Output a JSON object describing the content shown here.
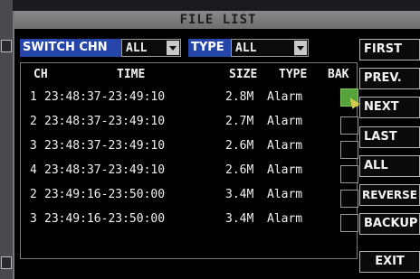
{
  "window": {
    "title": "FILE LIST"
  },
  "filters": {
    "switch_chn_label": "SWITCH CHN",
    "switch_chn_value": "ALL",
    "type_label": "TYPE",
    "type_value": "ALL"
  },
  "table": {
    "columns": {
      "ch": "CH",
      "time": "TIME",
      "size": "SIZE",
      "type": "TYPE",
      "bak": "BAK"
    },
    "rows": [
      {
        "ch": "1",
        "time": "23:48:37-23:49:10",
        "size": "2.8M",
        "type": "Alarm",
        "bak": true
      },
      {
        "ch": "2",
        "time": "23:48:37-23:49:10",
        "size": "2.7M",
        "type": "Alarm",
        "bak": false
      },
      {
        "ch": "3",
        "time": "23:48:37-23:49:10",
        "size": "2.6M",
        "type": "Alarm",
        "bak": false
      },
      {
        "ch": "4",
        "time": "23:48:37-23:49:10",
        "size": "2.6M",
        "type": "Alarm",
        "bak": false
      },
      {
        "ch": "2",
        "time": "23:49:16-23:50:00",
        "size": "3.4M",
        "type": "Alarm",
        "bak": false
      },
      {
        "ch": "3",
        "time": "23:49:16-23:50:00",
        "size": "3.4M",
        "type": "Alarm",
        "bak": false
      }
    ]
  },
  "buttons": {
    "first": "FIRST",
    "prev": "PREV.",
    "next": "NEXT",
    "last": "LAST",
    "all": "ALL",
    "reverse": "REVERSE",
    "backup": "BACKUP",
    "exit": "EXIT"
  },
  "colors": {
    "label_bg": "#2545a8",
    "checked_bg": "#55a33a",
    "title_bg": "#7a7a7a"
  },
  "icons": {
    "cursor": "mouse-pointer-icon",
    "dropdown": "chevron-down-icon"
  }
}
